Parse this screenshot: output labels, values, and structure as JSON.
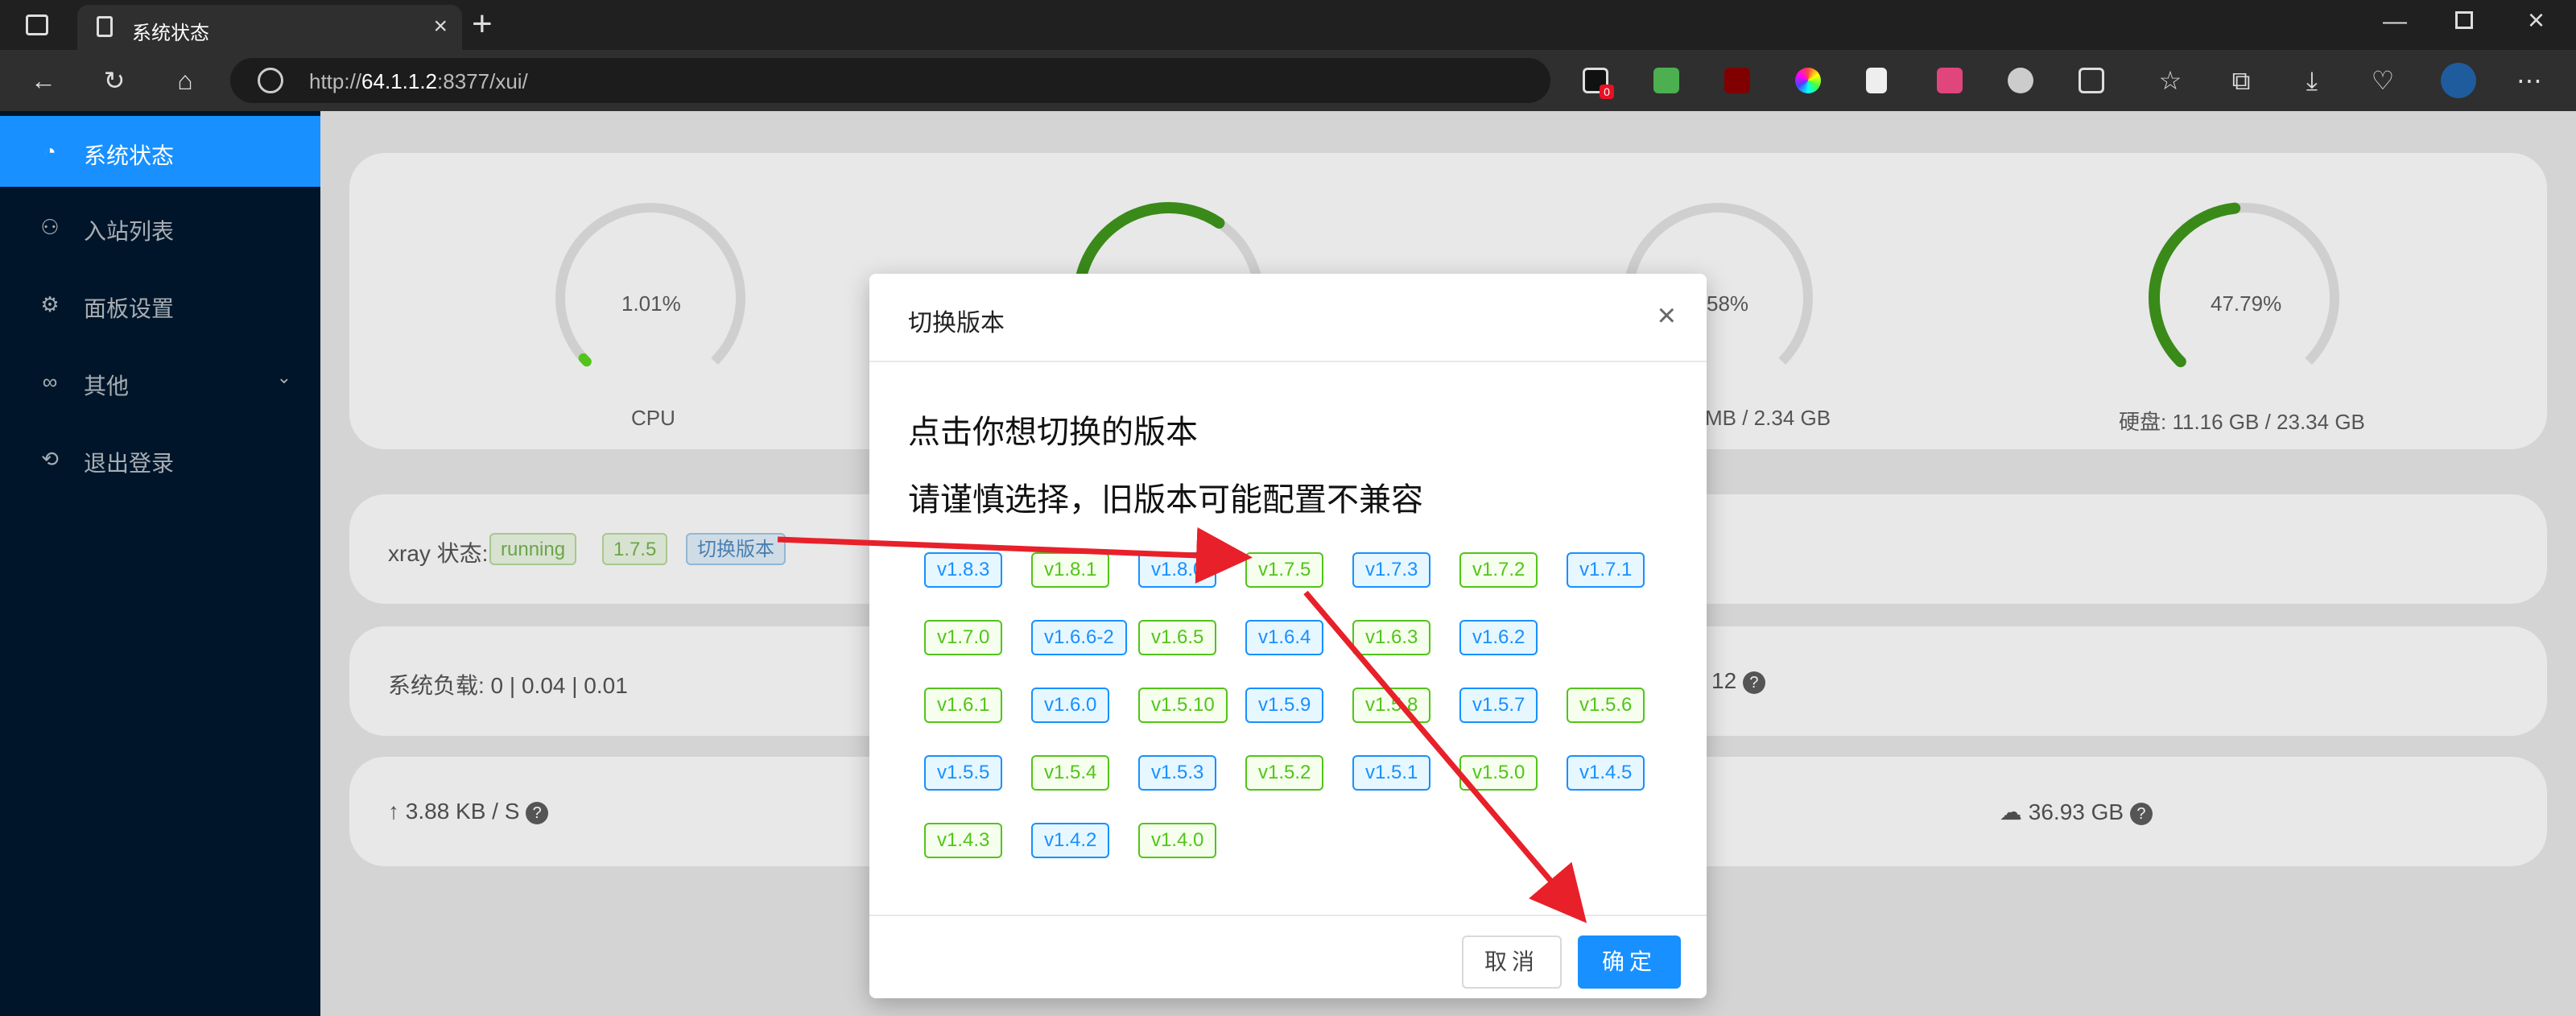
{
  "browser": {
    "tab_title": "系统状态",
    "address": {
      "prefix": "http://",
      "host": "64.1.1.2",
      "rest": ":8377/xui/"
    },
    "extension_badge": "0"
  },
  "sidebar": {
    "items": [
      {
        "label": "系统状态",
        "icon": "dashboard-icon"
      },
      {
        "label": "入站列表",
        "icon": "user-icon"
      },
      {
        "label": "面板设置",
        "icon": "gear-icon"
      },
      {
        "label": "其他",
        "icon": "link-icon"
      },
      {
        "label": "退出登录",
        "icon": "logout-icon"
      }
    ]
  },
  "dashboard": {
    "gauges": [
      {
        "value": "1.01%",
        "label": "CPU",
        "percent": 1.01,
        "color": "#52c41a"
      },
      {
        "value": "",
        "label": "",
        "percent": 63,
        "color": "#3a8a1a"
      },
      {
        "value": "58%",
        "label": "MB / 2.34 GB",
        "percent": 0,
        "color": "#52c41a"
      },
      {
        "value": "47.79%",
        "label": "硬盘: 11.16 GB / 23.34 GB",
        "percent": 47.79,
        "color": "#3a8a1a"
      }
    ],
    "xray_label": "xray 状态:",
    "xray_status": "running",
    "xray_version": "1.7.5",
    "switch_version": "切换版本",
    "load": "系统负载: 0 | 0.04 | 0.01",
    "partial_value": "12",
    "upload": "↑ 3.88 KB / S",
    "download_total": "36.93 GB"
  },
  "modal": {
    "title": "切换版本",
    "line1": "点击你想切换的版本",
    "line2": "请谨慎选择，旧版本可能配置不兼容",
    "versions": [
      {
        "v": "v1.8.3",
        "c": "b"
      },
      {
        "v": "v1.8.1",
        "c": "g"
      },
      {
        "v": "v1.8.0",
        "c": "b"
      },
      {
        "v": "v1.7.5",
        "c": "g"
      },
      {
        "v": "v1.7.3",
        "c": "b"
      },
      {
        "v": "v1.7.2",
        "c": "g"
      },
      {
        "v": "v1.7.1",
        "c": "b"
      },
      {
        "v": "v1.7.0",
        "c": "g"
      },
      {
        "v": "v1.6.6-2",
        "c": "b"
      },
      {
        "v": "v1.6.5",
        "c": "g"
      },
      {
        "v": "v1.6.4",
        "c": "b"
      },
      {
        "v": "v1.6.3",
        "c": "g"
      },
      {
        "v": "v1.6.2",
        "c": "b"
      },
      {
        "v": "v1.6.1",
        "c": "g"
      },
      {
        "v": "v1.6.0",
        "c": "b"
      },
      {
        "v": "v1.5.10",
        "c": "g"
      },
      {
        "v": "v1.5.9",
        "c": "b"
      },
      {
        "v": "v1.5.8",
        "c": "g"
      },
      {
        "v": "v1.5.7",
        "c": "b"
      },
      {
        "v": "v1.5.6",
        "c": "g"
      },
      {
        "v": "v1.5.5",
        "c": "b"
      },
      {
        "v": "v1.5.4",
        "c": "g"
      },
      {
        "v": "v1.5.3",
        "c": "b"
      },
      {
        "v": "v1.5.2",
        "c": "g"
      },
      {
        "v": "v1.5.1",
        "c": "b"
      },
      {
        "v": "v1.5.0",
        "c": "g"
      },
      {
        "v": "v1.4.5",
        "c": "b"
      },
      {
        "v": "v1.4.3",
        "c": "g"
      },
      {
        "v": "v1.4.2",
        "c": "b"
      },
      {
        "v": "v1.4.0",
        "c": "g"
      }
    ],
    "cancel": "取消",
    "ok": "确定"
  }
}
